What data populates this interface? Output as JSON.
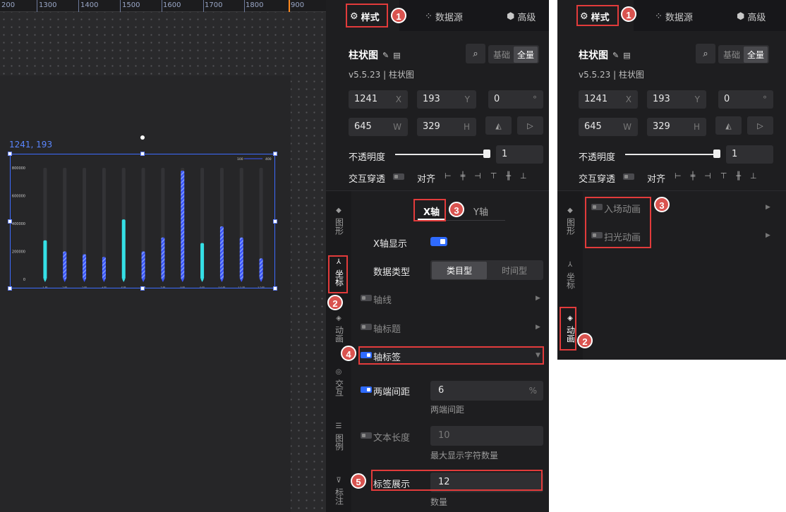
{
  "ruler": {
    "ticks": [
      "200",
      "1300",
      "1400",
      "1500",
      "1600",
      "1700",
      "1800",
      "900"
    ]
  },
  "canvas": {
    "position_label": "1241, 193",
    "legend_labels": [
      "100",
      "400"
    ]
  },
  "chart_data": {
    "type": "bar",
    "categories": [
      "1月",
      "2月",
      "3月",
      "4月",
      "5月",
      "6月",
      "7月",
      "8月",
      "9月",
      "10月",
      "11月",
      "12月"
    ],
    "values": [
      280000,
      200000,
      180000,
      160000,
      430000,
      200000,
      300000,
      780000,
      260000,
      380000,
      300000,
      150000
    ],
    "styles": [
      "solid",
      "striped",
      "striped",
      "striped",
      "solid",
      "striped",
      "striped",
      "striped",
      "solid",
      "striped",
      "striped",
      "striped"
    ],
    "ylim": [
      0,
      800000
    ],
    "yticks": [
      "800000",
      "600000",
      "400000",
      "200000",
      "0"
    ],
    "colors": {
      "solid": "#35e0e6",
      "striped": "#3b55ff"
    },
    "grid": false,
    "legend_placement": "top-right"
  },
  "panel": {
    "tabs": [
      {
        "label": "样式",
        "icon": "sliders-icon"
      },
      {
        "label": "数据源",
        "icon": "dots-icon"
      },
      {
        "label": "高级",
        "icon": "cube-icon"
      }
    ],
    "component_title": "柱状图",
    "version": "v5.5.23 | 柱状图",
    "mode_options": [
      "基础",
      "全量"
    ],
    "mode_selected": "全量",
    "fields": {
      "x": {
        "value": "1241",
        "unit": "X"
      },
      "y": {
        "value": "193",
        "unit": "Y"
      },
      "rotation": {
        "value": "0",
        "unit": "°"
      },
      "width": {
        "value": "645",
        "unit": "W"
      },
      "height": {
        "value": "329",
        "unit": "H"
      }
    },
    "opacity_label": "不透明度",
    "opacity_value": "1",
    "opacity": 1,
    "passthrough_label": "交互穿透",
    "align_label": "对齐",
    "side_nav": [
      "图形",
      "坐标",
      "动画",
      "交互",
      "图例",
      "标注"
    ],
    "axis_tabs": [
      "X轴",
      "Y轴"
    ],
    "x_axis_show_label": "X轴显示",
    "data_type_label": "数据类型",
    "data_type_options": [
      "类目型",
      "时间型"
    ],
    "data_type_selected": "类目型",
    "sections": {
      "axis_line": "轴线",
      "axis_title": "轴标题",
      "axis_label": "轴标签"
    },
    "padding_label": "两端间距",
    "padding_value": "6",
    "padding_unit": "%",
    "padding_hint": "两端间距",
    "text_length_label": "文本长度",
    "text_length_value": "10",
    "text_length_hint": "最大显示字符数量",
    "label_count_label": "标签展示",
    "label_count_value": "12",
    "label_count_hint": "数量"
  },
  "panel2": {
    "side_nav": [
      "图形",
      "坐标",
      "动画"
    ],
    "animations": [
      "入场动画",
      "扫光动画"
    ]
  },
  "badges": [
    "1",
    "2",
    "3",
    "4",
    "5"
  ]
}
